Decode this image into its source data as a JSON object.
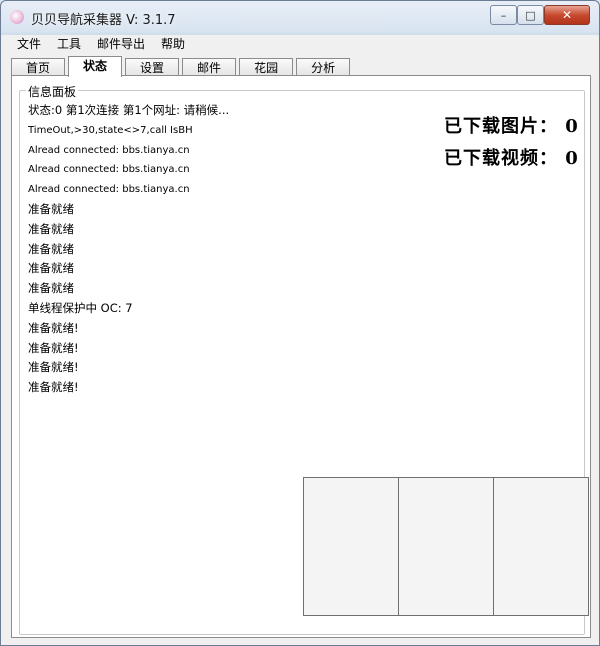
{
  "window": {
    "title": "贝贝导航采集器 V: 3.1.7",
    "minimize_glyph": "–",
    "maximize_glyph": "□",
    "close_glyph": "✕"
  },
  "menu": [
    "文件",
    "工具",
    "邮件导出",
    "帮助"
  ],
  "tabs": [
    "首页",
    "状态",
    "设置",
    "邮件",
    "花园",
    "分析"
  ],
  "active_tab": "状态",
  "info_panel": {
    "title": "信息面板",
    "log": [
      "状态:0 第1次连接 第1个网址: 请稍候...",
      "TimeOut,>30,state<>7,call IsBH",
      "Alread connected: bbs.tianya.cn",
      "Alread connected: bbs.tianya.cn",
      "Alread connected: bbs.tianya.cn",
      "准备就绪",
      "准备就绪",
      "准备就绪",
      "准备就绪",
      "准备就绪",
      "单线程保护中    OC: 7",
      "准备就绪!",
      "准备就绪!",
      "准备就绪!",
      "准备就绪!"
    ]
  },
  "stats": {
    "images_downloaded": "已下载图片： 0",
    "videos_downloaded": "已下载视频： 0"
  }
}
